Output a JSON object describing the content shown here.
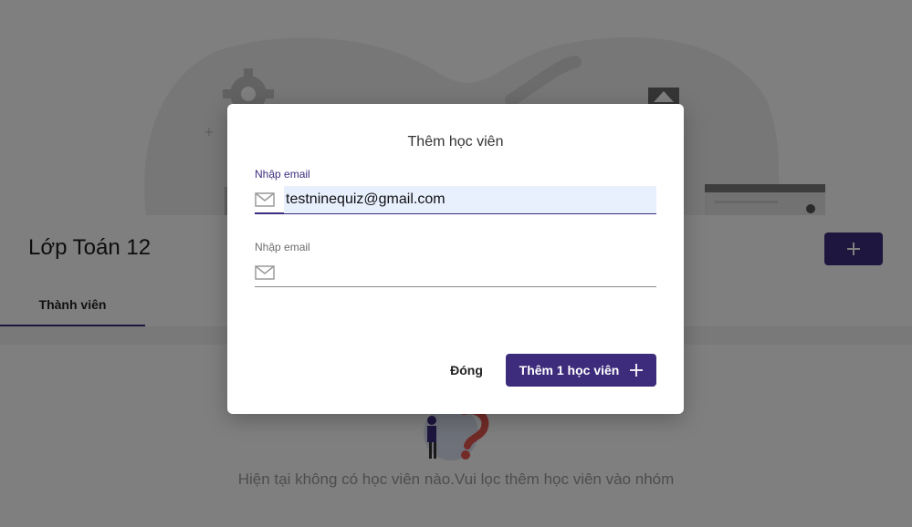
{
  "page": {
    "class_name": "Lớp Toán 12",
    "tabs": [
      {
        "label": "Thành viên"
      }
    ],
    "empty_message": "Hiện tại không có học viên nào.Vui lọc thêm học viên vào nhóm",
    "add_icon": "plus-icon"
  },
  "dialog": {
    "title": "Thêm học viên",
    "fields": [
      {
        "label": "Nhập email",
        "value": "testninequiz@gmail.com",
        "icon": "mail-icon"
      },
      {
        "label": "Nhập email",
        "value": "",
        "icon": "mail-icon"
      }
    ],
    "close_label": "Đóng",
    "submit_label": "Thêm 1 học viên",
    "submit_icon": "plus-icon"
  },
  "colors": {
    "accent": "#3d2c7c",
    "overlay": "rgba(0,0,0,0.5)",
    "autofill": "#e8f0fe"
  }
}
